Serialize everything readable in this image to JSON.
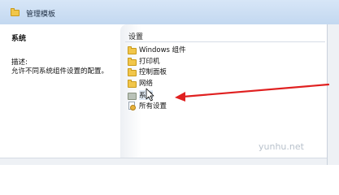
{
  "window": {
    "title": "管理模板"
  },
  "left_pane": {
    "heading": "系统",
    "description_label": "描述:",
    "description_text": "允许不同系统组件设置的配置。"
  },
  "right_pane": {
    "column_header": "设置",
    "items": [
      {
        "label": "Windows 组件",
        "icon": "folder-icon"
      },
      {
        "label": "打印机",
        "icon": "folder-icon"
      },
      {
        "label": "控制面板",
        "icon": "folder-icon"
      },
      {
        "label": "网络",
        "icon": "folder-icon"
      },
      {
        "label": "系统",
        "icon": "system-folder-icon"
      },
      {
        "label": "所有设置",
        "icon": "all-settings-icon"
      }
    ]
  },
  "watermark": "yunhu.net",
  "colors": {
    "annotation_arrow": "#e02020",
    "folder": "#f1c64a"
  }
}
